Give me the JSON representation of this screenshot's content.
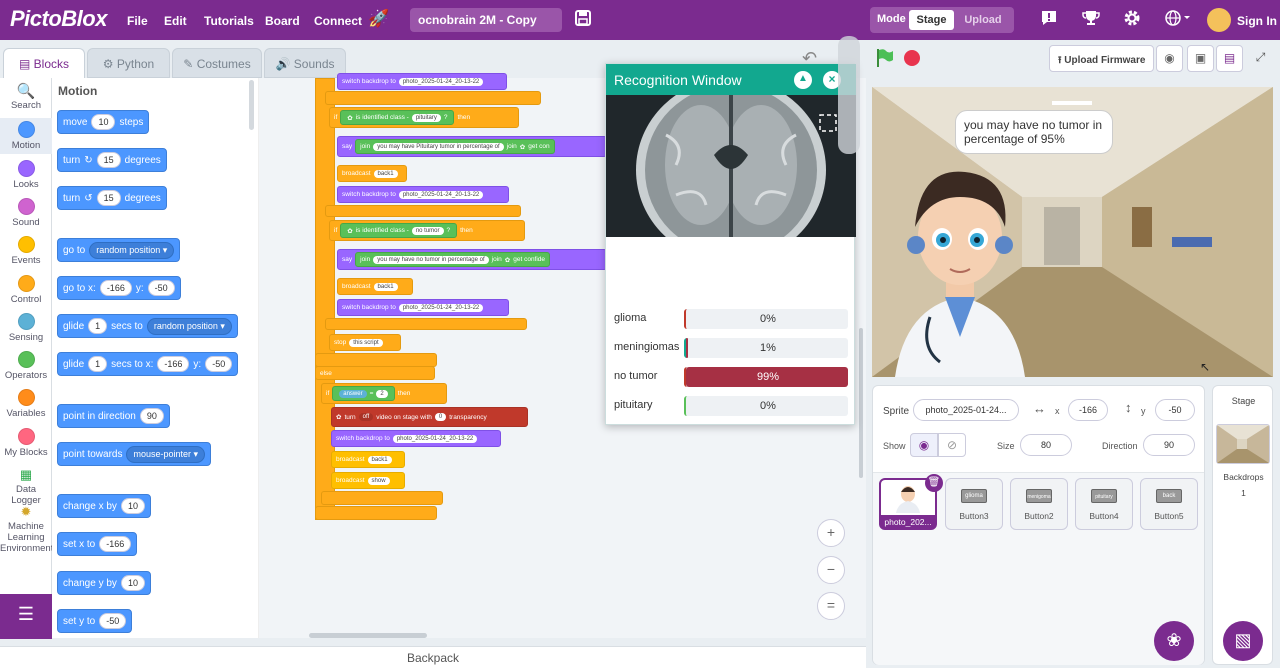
{
  "app": {
    "logo": "PictoBlox",
    "project_name": "ocnobrain 2M - Copy",
    "accent": "#7b2b8f"
  },
  "menu": [
    "File",
    "Edit",
    "Tutorials",
    "Board",
    "Connect"
  ],
  "mode": {
    "label": "Mode",
    "stage": "Stage",
    "upload": "Upload"
  },
  "signin": "Sign In",
  "tabs": {
    "blocks": "Blocks",
    "python": "Python",
    "costumes": "Costumes",
    "sounds": "Sounds"
  },
  "categories": [
    {
      "label": "Search",
      "color": "#4c97ff"
    },
    {
      "label": "Motion",
      "color": "#4c97ff"
    },
    {
      "label": "Looks",
      "color": "#9966ff"
    },
    {
      "label": "Sound",
      "color": "#cf63cf"
    },
    {
      "label": "Events",
      "color": "#ffbf00"
    },
    {
      "label": "Control",
      "color": "#ffab19"
    },
    {
      "label": "Sensing",
      "color": "#5cb1d6"
    },
    {
      "label": "Operators",
      "color": "#59c059"
    },
    {
      "label": "Variables",
      "color": "#ff8c1a"
    },
    {
      "label": "My Blocks",
      "color": "#ff6680"
    },
    {
      "label": "Data Logger",
      "color": "#2aa84a"
    },
    {
      "label": "Machine Learning Environment",
      "color": "#d4a72c"
    }
  ],
  "flyout": {
    "title": "Motion",
    "move": {
      "a": "move",
      "v": "10",
      "b": "steps"
    },
    "turn_right": {
      "a": "turn",
      "v": "15",
      "b": "degrees"
    },
    "turn_left": {
      "a": "turn",
      "v": "15",
      "b": "degrees"
    },
    "goto": {
      "a": "go to",
      "dd": "random position"
    },
    "gotoxy": {
      "a": "go to x:",
      "x": "-166",
      "b": "y:",
      "y": "-50"
    },
    "glide": {
      "a": "glide",
      "v": "1",
      "b": "secs to",
      "dd": "random position"
    },
    "glidexy": {
      "a": "glide",
      "v": "1",
      "b": "secs to x:",
      "x": "-166",
      "c": "y:",
      "y": "-50"
    },
    "point_dir": {
      "a": "point in direction",
      "v": "90"
    },
    "point_towards": {
      "a": "point towards",
      "dd": "mouse-pointer"
    },
    "change_x": {
      "a": "change x by",
      "v": "10"
    },
    "set_x": {
      "a": "set x to",
      "v": "-166"
    },
    "change_y": {
      "a": "change y by",
      "v": "10"
    },
    "set_y": {
      "a": "set y to",
      "v": "-50"
    }
  },
  "script": {
    "switch_backdrop": "switch backdrop to",
    "backdrop_name": "photo_2025-01-24_20-13-22",
    "if": "if",
    "then": "then",
    "else": "else",
    "is_identified": "is identified class -",
    "pituitary": "pituitary",
    "no_tumor": "no tumor",
    "q": "?",
    "say": "say",
    "join": "join",
    "pit_text": "you may have Pituitary tumor in percentage of",
    "no_text": "you may have no tumor in percentage of",
    "get_conf1": "get con",
    "get_conf2": "get confide",
    "broadcast": "broadcast",
    "back1": "back1",
    "show": "show",
    "stop": "stop",
    "this_script": "this script",
    "answer": "answer",
    "eq": "=",
    "two": "2",
    "turn": "turn",
    "off": "off",
    "video_text": "video on stage with",
    "zero": "0",
    "transparency": "transparency"
  },
  "recognition": {
    "title": "Recognition Window",
    "classes": [
      {
        "name": "glioma",
        "pct": "0%",
        "value": 0
      },
      {
        "name": "meningiomas",
        "pct": "1%",
        "value": 1
      },
      {
        "name": "no tumor",
        "pct": "99%",
        "value": 99
      },
      {
        "name": "pituitary",
        "pct": "0%",
        "value": 0
      }
    ]
  },
  "stage_toolbar": {
    "upload_firmware": "Upload Firmware"
  },
  "bubble": "you may have no tumor in percentage of 95%",
  "sprite": {
    "label": "Sprite",
    "name": "photo_2025-01-24...",
    "x_label": "x",
    "x": "-166",
    "y_label": "y",
    "y": "-50",
    "show_label": "Show",
    "size_label": "Size",
    "size": "80",
    "direction_label": "Direction",
    "direction": "90"
  },
  "sprites": [
    {
      "label": "photo_202...",
      "thumb": ""
    },
    {
      "label": "Button3",
      "thumb": "glioma"
    },
    {
      "label": "Button2",
      "thumb": "menigoma"
    },
    {
      "label": "Button4",
      "thumb": "pituitary"
    },
    {
      "label": "Button5",
      "thumb": "back"
    }
  ],
  "stage_panel": {
    "title": "Stage",
    "backdrops_label": "Backdrops",
    "backdrops_count": "1"
  },
  "backpack": "Backpack"
}
